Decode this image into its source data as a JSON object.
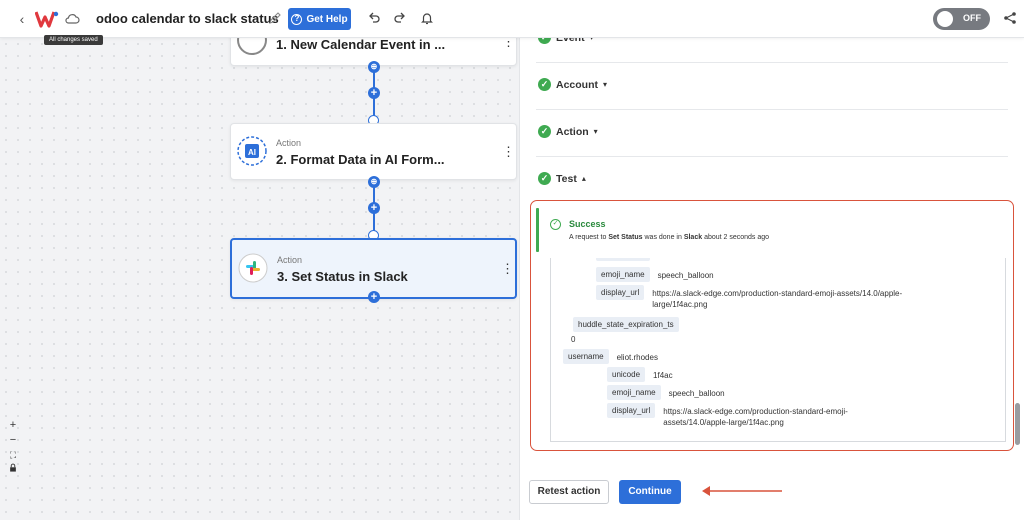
{
  "header": {
    "back_icon": "chevron-left-icon",
    "logo_icon": "w-logo-icon",
    "cloud_icon": "cloud-icon",
    "title": "odoo calendar to slack status",
    "edit_icon": "pencil-icon",
    "help_button": "Get Help",
    "undo_icon": "undo-icon",
    "redo_icon": "redo-icon",
    "bell_icon": "bell-icon",
    "toggle_label": "OFF",
    "share_icon": "share-icon",
    "saved_tooltip": "All changes saved"
  },
  "colors": {
    "accent": "#2d6fd9",
    "success": "#3faa51",
    "highlight_border": "#d9533c",
    "arrow": "#d9533c"
  },
  "steps": [
    {
      "kind": "",
      "name": "1. New Calendar Event in ...",
      "icon": "odoo-app-icon"
    },
    {
      "kind": "Action",
      "name": "2. Format Data in AI Form...",
      "icon": "ai-format-icon"
    },
    {
      "kind": "Action",
      "name": "3. Set Status in Slack",
      "icon": "slack-icon"
    }
  ],
  "zoom_controls": [
    "+",
    "−",
    "⛶",
    "🔒"
  ],
  "panel": {
    "sections": [
      {
        "label": "Event",
        "expanded": false
      },
      {
        "label": "Account",
        "expanded": false
      },
      {
        "label": "Action",
        "expanded": false
      },
      {
        "label": "Test",
        "expanded": true
      }
    ],
    "result": {
      "status": "Success",
      "message_prefix": "A request to",
      "message_action": "Set Status",
      "message_mid": "was done in",
      "message_app": "Slack",
      "message_time": "about 2 seconds ago",
      "tree": [
        {
          "key": "emoji_name",
          "value": "speech_balloon"
        },
        {
          "key": "display_url",
          "value": "https://a.slack-edge.com/production-standard-emoji-assets/14.0/apple-large/1f4ac.png"
        },
        {
          "key": "huddle_state_expiration_ts",
          "value": ""
        },
        {
          "key": "",
          "value": "0"
        },
        {
          "key": "username",
          "value": "eliot.rhodes"
        },
        {
          "key": "unicode",
          "value": "1f4ac"
        },
        {
          "key": "emoji_name",
          "value": "speech_balloon"
        },
        {
          "key": "display_url",
          "value": "https://a.slack-edge.com/production-standard-emoji-assets/14.0/apple-large/1f4ac.png"
        }
      ]
    },
    "retest_button": "Retest action",
    "continue_button": "Continue"
  }
}
